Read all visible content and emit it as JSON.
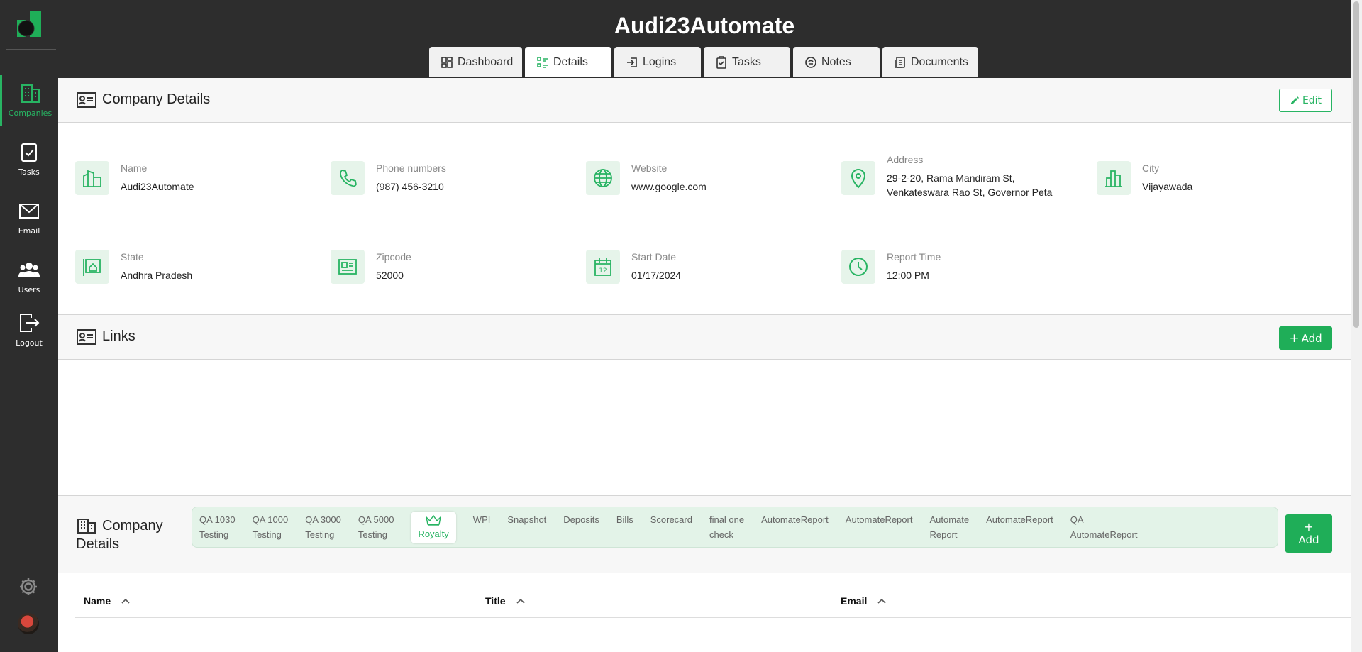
{
  "app": {
    "title": "Audi23Automate"
  },
  "sidebar": {
    "items": [
      {
        "label": "Companies",
        "icon": "building-icon",
        "active": true
      },
      {
        "label": "Tasks",
        "icon": "clipboard-check-icon",
        "active": false
      },
      {
        "label": "Email",
        "icon": "envelope-icon",
        "active": false
      },
      {
        "label": "Users",
        "icon": "users-icon",
        "active": false
      },
      {
        "label": "Logout",
        "icon": "logout-icon",
        "active": false
      }
    ]
  },
  "tabs": [
    {
      "label": "Dashboard",
      "icon": "dashboard-icon",
      "active": false
    },
    {
      "label": "Details",
      "icon": "list-icon",
      "active": true
    },
    {
      "label": "Logins",
      "icon": "login-icon",
      "active": false
    },
    {
      "label": "Tasks",
      "icon": "clipboard-icon",
      "active": false
    },
    {
      "label": "Notes",
      "icon": "notes-icon",
      "active": false
    },
    {
      "label": "Documents",
      "icon": "documents-icon",
      "active": false
    }
  ],
  "company_details": {
    "title": "Company Details",
    "edit_label": "Edit",
    "fields": {
      "name": {
        "label": "Name",
        "value": "Audi23Automate"
      },
      "phone": {
        "label": "Phone numbers",
        "value": "(987) 456-3210"
      },
      "website": {
        "label": "Website",
        "value": "www.google.com"
      },
      "address": {
        "label": "Address",
        "line1": "29-2-20, Rama Mandiram St,",
        "line2": "Venkateswara Rao St, Governor Peta"
      },
      "city": {
        "label": "City",
        "value": "Vijayawada"
      },
      "state": {
        "label": "State",
        "value": "Andhra Pradesh"
      },
      "zipcode": {
        "label": "Zipcode",
        "value": "52000"
      },
      "start_date": {
        "label": "Start Date",
        "value": "01/17/2024"
      },
      "report_time": {
        "label": "Report Time",
        "value": "12:00 PM"
      }
    }
  },
  "links": {
    "title": "Links",
    "add_label": "Add"
  },
  "contacts": {
    "title_line1": "Company",
    "title_line2": "Details",
    "add_line1": "+",
    "add_line2": "Add",
    "subtabs": [
      {
        "line1": "QA 1030",
        "line2": "Testing"
      },
      {
        "line1": "QA 1000",
        "line2": "Testing"
      },
      {
        "line1": "QA 3000",
        "line2": "Testing"
      },
      {
        "line1": "QA 5000",
        "line2": "Testing"
      },
      {
        "line1": "",
        "line2": "Royalty",
        "icon": "crown-icon",
        "active": true
      },
      {
        "line1": "WPI",
        "line2": ""
      },
      {
        "line1": "Snapshot",
        "line2": ""
      },
      {
        "line1": "Deposits",
        "line2": ""
      },
      {
        "line1": "Bills",
        "line2": ""
      },
      {
        "line1": "Scorecard",
        "line2": ""
      },
      {
        "line1": "final one",
        "line2": "check"
      },
      {
        "line1": "AutomateReport",
        "line2": ""
      },
      {
        "line1": "AutomateReport",
        "line2": ""
      },
      {
        "line1": "Automate",
        "line2": "Report"
      },
      {
        "line1": "AutomateReport",
        "line2": ""
      },
      {
        "line1": "QA",
        "line2": "AutomateReport"
      }
    ],
    "columns": [
      "Name",
      "Title",
      "Email"
    ]
  },
  "colors": {
    "accent": "#28b463",
    "dark": "#2d2d2d",
    "icon_bg": "#e6f4ea"
  }
}
